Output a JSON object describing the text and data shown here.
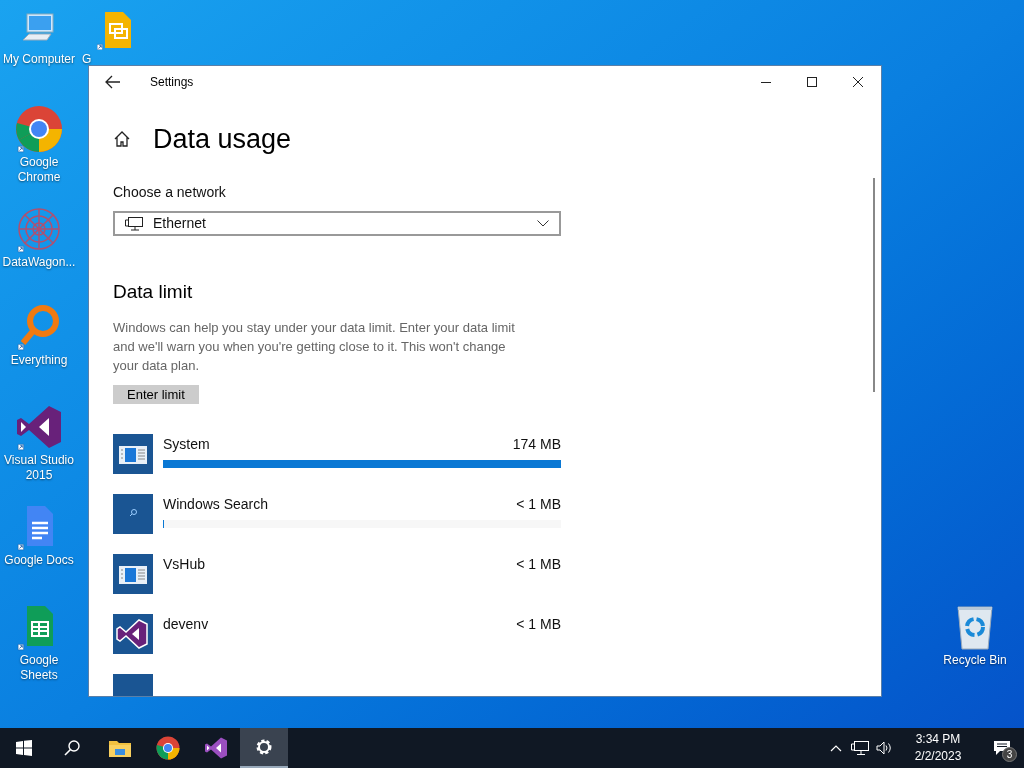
{
  "desktop_icons": [
    {
      "label": "My Computer",
      "kind": "computer"
    },
    {
      "label": "G",
      "kind": "slides"
    },
    {
      "label": "Google Chrome",
      "kind": "chrome"
    },
    {
      "label": "DataWagon...",
      "kind": "datawagon"
    },
    {
      "label": "Everything",
      "kind": "everything"
    },
    {
      "label": "Visual Studio 2015",
      "kind": "vs"
    },
    {
      "label": "Google Docs",
      "kind": "docs"
    },
    {
      "label": "Google Sheets",
      "kind": "sheets"
    },
    {
      "label": "Recycle Bin",
      "kind": "recycle"
    }
  ],
  "window": {
    "title": "Settings"
  },
  "page": {
    "title": "Data usage",
    "network_label": "Choose a network",
    "network": "Ethernet",
    "limit_heading": "Data limit",
    "limit_text": "Windows can help you stay under your data limit. Enter your data limit and we'll warn you when you're getting close to it. This won't change your data plan.",
    "limit_button": "Enter limit"
  },
  "apps": [
    {
      "name": "System",
      "usage": "174 MB",
      "level": 1,
      "kind": "window"
    },
    {
      "name": "Windows Search",
      "usage": "< 1 MB",
      "level": 0.003,
      "kind": "search"
    },
    {
      "name": "VsHub",
      "usage": "< 1 MB",
      "kind": "window"
    },
    {
      "name": "devenv",
      "usage": "< 1 MB",
      "kind": "vs"
    }
  ],
  "taskbar": {
    "items": [
      {
        "kind": "explorer",
        "selected": false
      },
      {
        "kind": "chrome",
        "selected": false
      },
      {
        "kind": "vs",
        "selected": false
      },
      {
        "kind": "settings",
        "selected": true
      }
    ],
    "time": "3:34 PM",
    "date": "2/2/2023",
    "notifications": "3"
  }
}
